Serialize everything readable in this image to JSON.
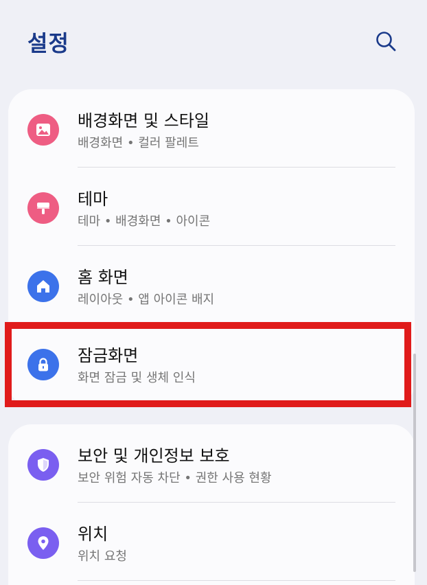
{
  "header": {
    "title": "설정",
    "search_icon": "search-icon"
  },
  "colors": {
    "title": "#1a3a8a",
    "pink": "#ee5d83",
    "blue": "#3c72ea",
    "purple": "#7a5ff0",
    "highlight": "#e01b1b"
  },
  "groups": [
    {
      "items": [
        {
          "label": "배경화면 및 스타일",
          "sub": "배경화면 • 컬러 팔레트",
          "icon": "image-icon"
        },
        {
          "label": "테마",
          "sub": "테마 • 배경화면 • 아이콘",
          "icon": "paintbrush-icon"
        },
        {
          "label": "홈 화면",
          "sub": "레이아웃 • 앱 아이콘 배지",
          "icon": "home-icon"
        },
        {
          "label": "잠금화면",
          "sub": "화면 잠금 및 생체 인식",
          "icon": "lock-icon"
        }
      ]
    },
    {
      "items": [
        {
          "label": "보안 및 개인정보 보호",
          "sub": "보안 위험 자동 차단 • 권한 사용 현황",
          "icon": "shield-icon"
        },
        {
          "label": "위치",
          "sub": "위치 요청",
          "icon": "location-pin-icon"
        }
      ]
    }
  ]
}
